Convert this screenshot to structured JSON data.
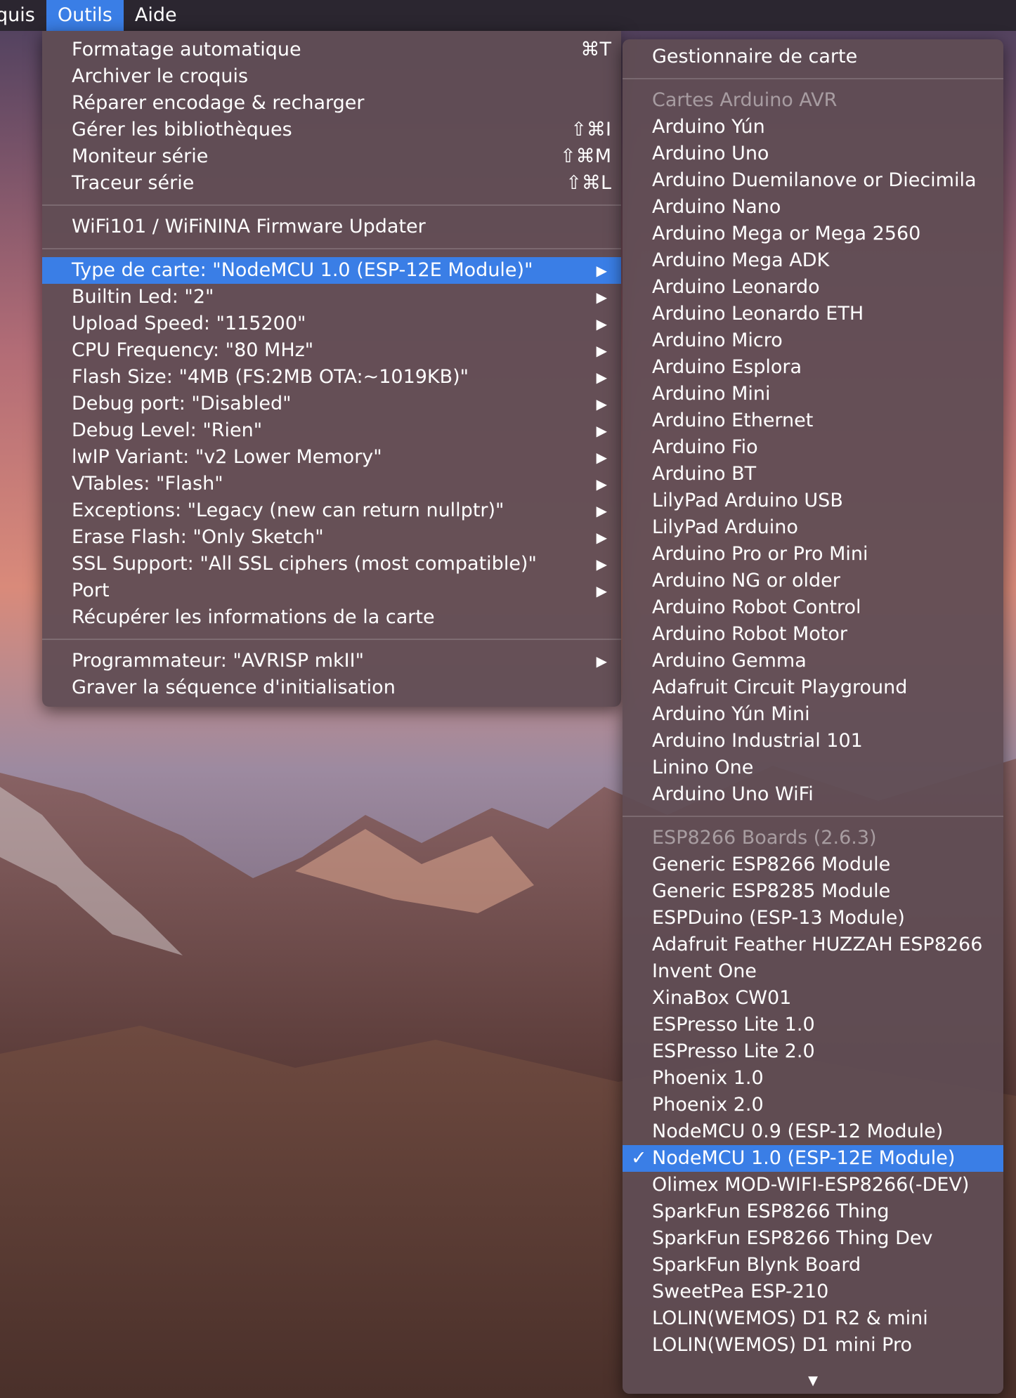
{
  "menubar": {
    "items": [
      {
        "label": "quis"
      },
      {
        "label": "Outils"
      },
      {
        "label": "Aide"
      }
    ]
  },
  "outils_menu": {
    "group1": [
      {
        "label": "Formatage automatique",
        "shortcut": "⌘T"
      },
      {
        "label": "Archiver le croquis",
        "shortcut": ""
      },
      {
        "label": "Réparer encodage & recharger",
        "shortcut": ""
      },
      {
        "label": "Gérer les bibliothèques",
        "shortcut": "⇧⌘I"
      },
      {
        "label": "Moniteur série",
        "shortcut": "⇧⌘M"
      },
      {
        "label": "Traceur série",
        "shortcut": "⇧⌘L"
      }
    ],
    "group2": [
      {
        "label": "WiFi101 / WiFiNINA Firmware Updater"
      }
    ],
    "group3": [
      {
        "label": "Type de carte: \"NodeMCU 1.0 (ESP-12E Module)\"",
        "submenu": true
      },
      {
        "label": "Builtin Led: \"2\"",
        "submenu": true
      },
      {
        "label": "Upload Speed: \"115200\"",
        "submenu": true
      },
      {
        "label": "CPU Frequency: \"80 MHz\"",
        "submenu": true
      },
      {
        "label": "Flash Size: \"4MB (FS:2MB OTA:~1019KB)\"",
        "submenu": true
      },
      {
        "label": "Debug port: \"Disabled\"",
        "submenu": true
      },
      {
        "label": "Debug Level: \"Rien\"",
        "submenu": true
      },
      {
        "label": "lwIP Variant: \"v2 Lower Memory\"",
        "submenu": true
      },
      {
        "label": "VTables: \"Flash\"",
        "submenu": true
      },
      {
        "label": "Exceptions: \"Legacy (new can return nullptr)\"",
        "submenu": true
      },
      {
        "label": "Erase Flash: \"Only Sketch\"",
        "submenu": true
      },
      {
        "label": "SSL Support: \"All SSL ciphers (most compatible)\"",
        "submenu": true
      },
      {
        "label": "Port",
        "submenu": true
      },
      {
        "label": "Récupérer les informations de la carte",
        "submenu": false
      }
    ],
    "group4": [
      {
        "label": "Programmateur: \"AVRISP mkII\"",
        "submenu": true
      },
      {
        "label": "Graver la séquence d'initialisation",
        "submenu": false
      }
    ],
    "arrow_glyph": "▶"
  },
  "boards_menu": {
    "manager": "Gestionnaire de carte",
    "avr_header": "Cartes Arduino AVR",
    "avr_boards": [
      "Arduino Yún",
      "Arduino Uno",
      "Arduino Duemilanove or Diecimila",
      "Arduino Nano",
      "Arduino Mega or Mega 2560",
      "Arduino Mega ADK",
      "Arduino Leonardo",
      "Arduino Leonardo ETH",
      "Arduino Micro",
      "Arduino Esplora",
      "Arduino Mini",
      "Arduino Ethernet",
      "Arduino Fio",
      "Arduino BT",
      "LilyPad Arduino USB",
      "LilyPad Arduino",
      "Arduino Pro or Pro Mini",
      "Arduino NG or older",
      "Arduino Robot Control",
      "Arduino Robot Motor",
      "Arduino Gemma",
      "Adafruit Circuit Playground",
      "Arduino Yún Mini",
      "Arduino Industrial 101",
      "Linino One",
      "Arduino Uno WiFi"
    ],
    "esp_header": "ESP8266 Boards (2.6.3)",
    "esp_boards": [
      "Generic ESP8266 Module",
      "Generic ESP8285 Module",
      "ESPDuino (ESP-13 Module)",
      "Adafruit Feather HUZZAH ESP8266",
      "Invent One",
      "XinaBox CW01",
      "ESPresso Lite 1.0",
      "ESPresso Lite 2.0",
      "Phoenix 1.0",
      "Phoenix 2.0",
      "NodeMCU 0.9 (ESP-12 Module)",
      "NodeMCU 1.0 (ESP-12E Module)",
      "Olimex MOD-WIFI-ESP8266(-DEV)",
      "SparkFun ESP8266 Thing",
      "SparkFun ESP8266 Thing Dev",
      "SparkFun Blynk Board",
      "SweetPea ESP-210",
      "LOLIN(WEMOS) D1 R2 & mini",
      "LOLIN(WEMOS) D1 mini Pro"
    ],
    "selected": "NodeMCU 1.0 (ESP-12E Module)",
    "check_glyph": "✓",
    "scroll_glyph": "▼"
  },
  "colors": {
    "highlight": "#3a7ee6",
    "menu_bg": "#604c54",
    "menubar_bg": "#2b2630"
  }
}
